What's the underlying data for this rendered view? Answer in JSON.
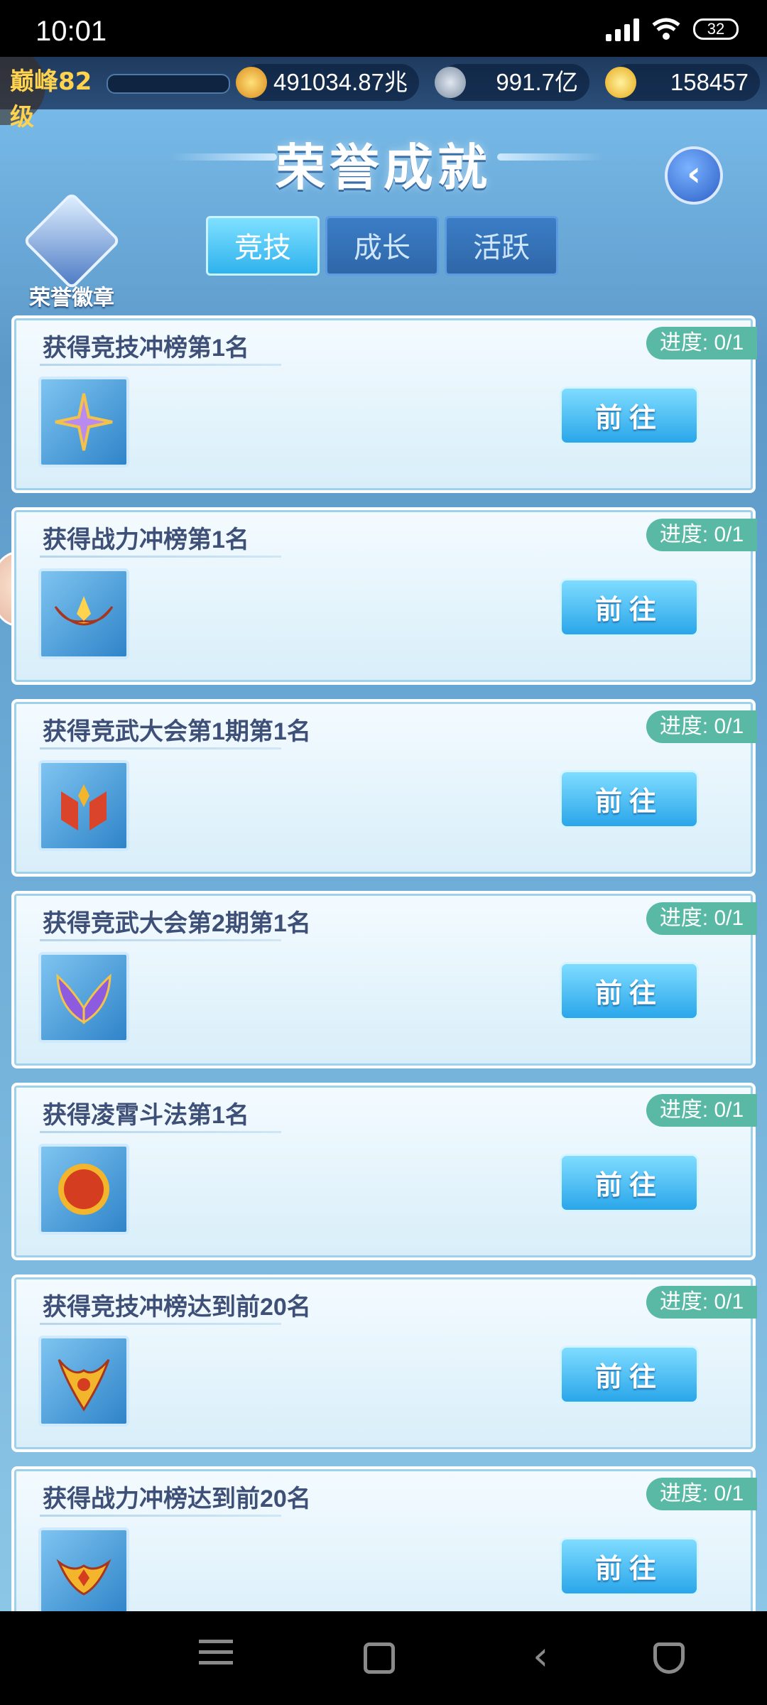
{
  "status_bar": {
    "time": "10:01",
    "battery": "32"
  },
  "resources": {
    "level": "巅峰82级",
    "power": "491034.87兆",
    "silver": "991.7亿",
    "gold": "158457"
  },
  "page": {
    "title": "荣誉成就",
    "badge_label": "荣誉徽章"
  },
  "tabs": [
    {
      "label": "竞技",
      "active": true
    },
    {
      "label": "成长",
      "active": false
    },
    {
      "label": "活跃",
      "active": false
    }
  ],
  "achievements": [
    {
      "name": "获得竞技冲榜第1名",
      "progress": "进度: 0/1",
      "button": "前往",
      "icon": "purple-star-sword-icon"
    },
    {
      "name": "获得战力冲榜第1名",
      "progress": "进度: 0/1",
      "button": "前往",
      "icon": "gold-crown-icon"
    },
    {
      "name": "获得竞武大会第1期第1名",
      "progress": "进度: 0/1",
      "button": "前往",
      "icon": "red-banner-icon"
    },
    {
      "name": "获得竞武大会第2期第1名",
      "progress": "进度: 0/1",
      "button": "前往",
      "icon": "purple-wings-icon"
    },
    {
      "name": "获得凌霄斗法第1名",
      "progress": "进度: 0/1",
      "button": "前往",
      "icon": "red-medallion-icon"
    },
    {
      "name": "获得竞技冲榜达到前20名",
      "progress": "进度: 0/1",
      "button": "前往",
      "icon": "gold-horn-crest-icon"
    },
    {
      "name": "获得战力冲榜达到前20名",
      "progress": "进度: 0/1",
      "button": "前往",
      "icon": "gold-flame-crest-icon"
    }
  ]
}
